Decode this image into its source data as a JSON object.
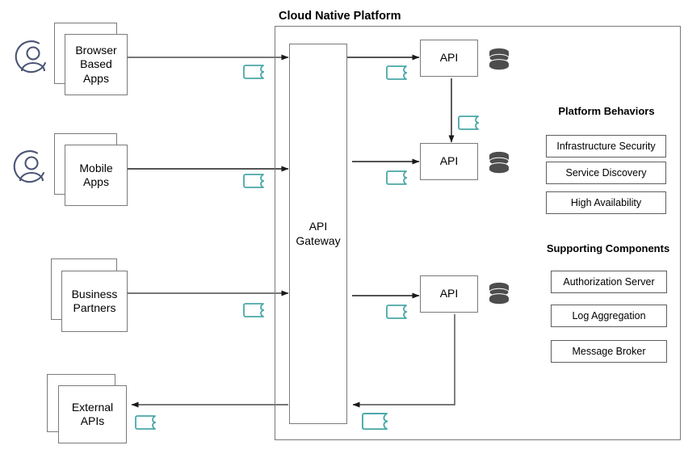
{
  "diagram": {
    "title": "Cloud Native Platform",
    "type": "architecture-diagram"
  },
  "consumers": [
    {
      "id": "browser-based-apps",
      "label": "Browser\nBased\nApps",
      "lines": [
        "Browser",
        "Based",
        "Apps"
      ],
      "actor_icon": "user-avatar-icon"
    },
    {
      "id": "mobile-apps",
      "label": "Mobile\nApps",
      "lines": [
        "Mobile",
        "Apps"
      ],
      "actor_icon": "user-avatar-icon"
    },
    {
      "id": "business-partners",
      "label": "Business\nPartners",
      "lines": [
        "Business",
        "Partners"
      ],
      "actor_icon": null
    },
    {
      "id": "external-apis",
      "label": "External\nAPIs",
      "lines": [
        "External",
        "APIs"
      ],
      "actor_icon": null
    }
  ],
  "gateway": {
    "label": "API\nGateway",
    "lines": [
      "API",
      "Gateway"
    ]
  },
  "services": [
    {
      "id": "api-1",
      "label": "API",
      "database_icon": "database-cylinder-icon"
    },
    {
      "id": "api-2",
      "label": "API",
      "database_icon": "database-cylinder-icon"
    },
    {
      "id": "api-3",
      "label": "API",
      "database_icon": "database-cylinder-icon"
    }
  ],
  "contracts": [
    {
      "id": "contract-browser",
      "icon": "api-contract-icon"
    },
    {
      "id": "contract-mobile",
      "icon": "api-contract-icon"
    },
    {
      "id": "contract-partners",
      "icon": "api-contract-icon"
    },
    {
      "id": "contract-external",
      "icon": "api-contract-icon"
    },
    {
      "id": "contract-api1",
      "icon": "api-contract-icon"
    },
    {
      "id": "contract-api1-api2",
      "icon": "api-contract-icon"
    },
    {
      "id": "contract-api2",
      "icon": "api-contract-icon"
    },
    {
      "id": "contract-api3",
      "icon": "api-contract-icon"
    },
    {
      "id": "contract-gateway-out",
      "icon": "api-contract-icon"
    }
  ],
  "platform_behaviors": {
    "title": "Platform Behaviors",
    "items": [
      {
        "label": "Infrastructure Security"
      },
      {
        "label": "Service Discovery"
      },
      {
        "label": "High Availability"
      }
    ]
  },
  "supporting_components": {
    "title": "Supporting Components",
    "items": [
      {
        "label": "Authorization Server"
      },
      {
        "label": "Log Aggregation"
      },
      {
        "label": "Message Broker"
      }
    ]
  },
  "colors": {
    "contract_teal": "#4aa8a8",
    "actor_blue": "#4a5574",
    "database_gray": "#4d4d4d",
    "box_border": "#7a7a7a",
    "arrow": "#1a1a1a",
    "background": "#ffffff"
  }
}
